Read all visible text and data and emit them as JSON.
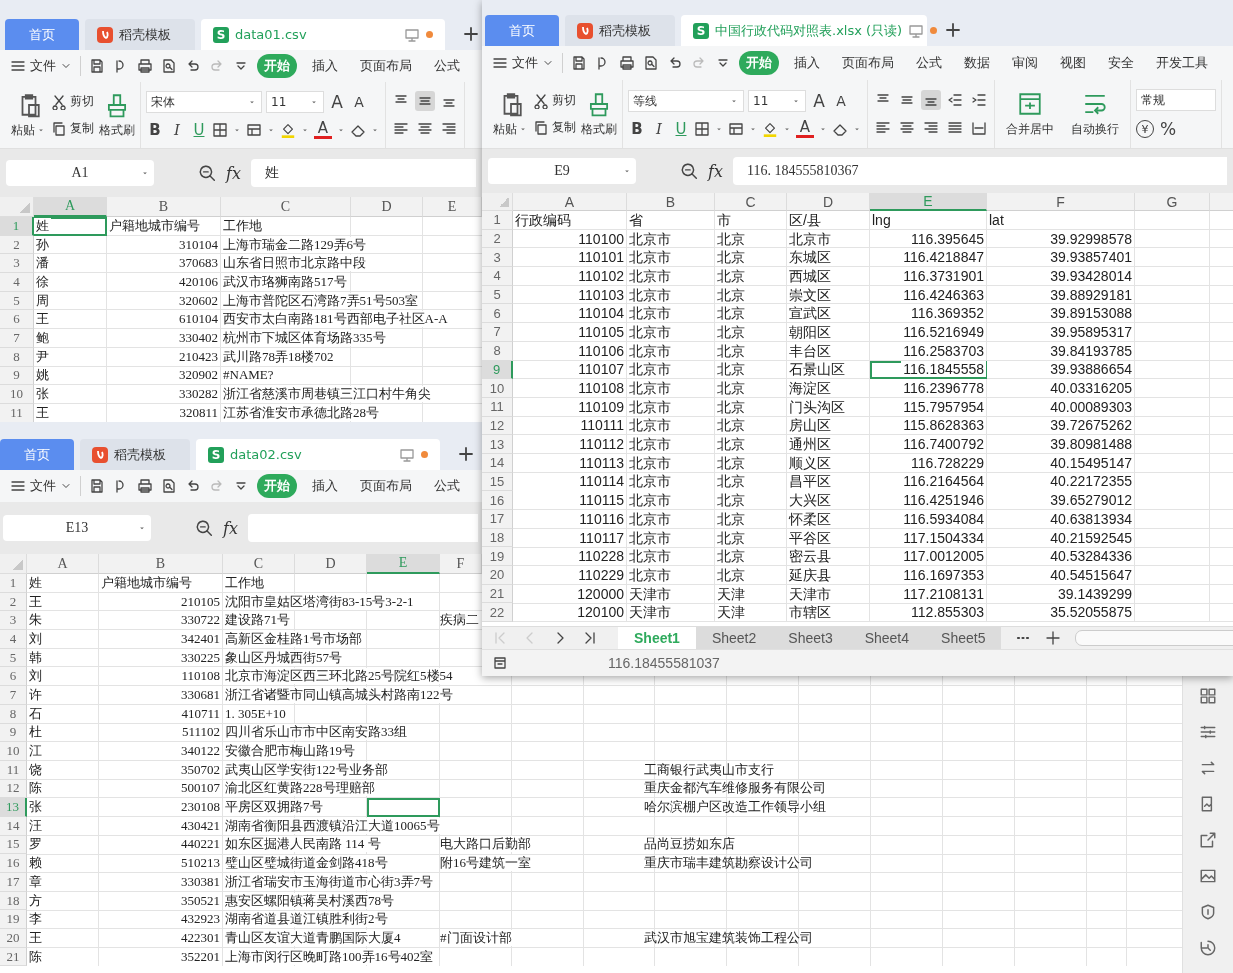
{
  "windows": [
    {
      "kind": "small",
      "tabs": [
        {
          "label": "首页",
          "kind": "home",
          "selected": false
        },
        {
          "label": "稻壳模板",
          "kind": "template",
          "selected": false
        },
        {
          "label": "data01.csv",
          "kind": "sheet",
          "badge": "S",
          "selected": true
        }
      ],
      "menu": {
        "file": "文件",
        "items": [
          {
            "label": "开始",
            "selected": true
          },
          {
            "label": "插入",
            "selected": false
          },
          {
            "label": "页面布局",
            "selected": false
          },
          {
            "label": "公式",
            "selected": false
          }
        ]
      },
      "ribbon": {
        "paste": "粘贴",
        "cut": "剪切",
        "copy": "复制",
        "format_painter": "格式刷",
        "font": "宋体",
        "font_size": "11",
        "grow": "A",
        "shrink": "A",
        "bold": "B",
        "italic": "I",
        "underline": "U",
        "font_color": "A",
        "align_buttons": [
          {
            "selected": false
          },
          {
            "selected": true
          },
          {
            "selected": false
          }
        ]
      },
      "formula_bar": {
        "name_box": "A1",
        "fx": "fx",
        "value": "姓"
      },
      "grid": {
        "columns": [
          {
            "label": "A",
            "selected": true
          },
          {
            "label": "B",
            "selected": false
          },
          {
            "label": "C",
            "selected": false
          },
          {
            "label": "D",
            "selected": false
          },
          {
            "label": "E",
            "selected": false
          }
        ],
        "rows": [
          {
            "num": "1",
            "selected": true,
            "cells": [
              "姓",
              "户籍地城市编号",
              "工作地"
            ]
          },
          {
            "num": "2",
            "selected": false,
            "cells": [
              "孙",
              "310104",
              "上海市瑞金二路129弄6号"
            ]
          },
          {
            "num": "3",
            "selected": false,
            "cells": [
              "潘",
              "370683",
              "山东省日照市北京路中段"
            ]
          },
          {
            "num": "4",
            "selected": false,
            "cells": [
              "徐",
              "420106",
              "武汉市珞狮南路517号"
            ]
          },
          {
            "num": "5",
            "selected": false,
            "cells": [
              "周",
              "320602",
              "上海市普陀区石湾路7弄51号503室"
            ]
          },
          {
            "num": "6",
            "selected": false,
            "cells": [
              "王",
              "610104",
              "西安市太白南路181号西部电子社区A-A"
            ]
          },
          {
            "num": "7",
            "selected": false,
            "cells": [
              "鲍",
              "330402",
              "杭州市下城区体育场路335号"
            ]
          },
          {
            "num": "8",
            "selected": false,
            "cells": [
              "尹",
              "210423",
              "武川路78弄18楼702"
            ]
          },
          {
            "num": "9",
            "selected": false,
            "cells": [
              "姚",
              "320902",
              "#NAME?"
            ]
          },
          {
            "num": "10",
            "selected": false,
            "cells": [
              "张",
              "330282",
              "浙江省慈溪市周巷镇三江口村牛角尖"
            ]
          },
          {
            "num": "11",
            "selected": false,
            "cells": [
              "王",
              "320811",
              "江苏省淮安市承德北路28号"
            ]
          }
        ]
      }
    },
    {
      "kind": "wide",
      "tabs": [
        {
          "label": "首页",
          "kind": "home",
          "selected": false
        },
        {
          "label": "稻壳模板",
          "kind": "template",
          "selected": false
        },
        {
          "label": "data02.csv",
          "kind": "sheet",
          "badge": "S",
          "selected": true
        }
      ],
      "menu": {
        "file": "文件",
        "items": [
          {
            "label": "开始",
            "selected": true
          },
          {
            "label": "插入",
            "selected": false
          },
          {
            "label": "页面布局",
            "selected": false
          },
          {
            "label": "公式",
            "selected": false
          }
        ]
      },
      "formula_bar": {
        "name_box": "E13",
        "fx": "fx"
      },
      "grid": {
        "columns": [
          {
            "label": "A",
            "selected": false
          },
          {
            "label": "B",
            "selected": false
          },
          {
            "label": "C",
            "selected": false
          },
          {
            "label": "D",
            "selected": false
          },
          {
            "label": "E",
            "selected": true
          },
          {
            "label": "F",
            "selected": false
          }
        ],
        "rows": [
          {
            "num": "1",
            "selected": false,
            "cells": [
              "姓",
              "户籍地城市编号",
              "工作地"
            ]
          },
          {
            "num": "2",
            "selected": false,
            "cells": [
              "王",
              "210105",
              "沈阳市皇姑区塔湾街83-15号3-2-1"
            ]
          },
          {
            "num": "3",
            "selected": false,
            "cells": [
              "朱",
              "330722",
              "建设路71号"
            ],
            "column_f": "疾病二"
          },
          {
            "num": "4",
            "selected": false,
            "cells": [
              "刘",
              "342401",
              "高新区金桂路1号市场部"
            ]
          },
          {
            "num": "5",
            "selected": false,
            "cells": [
              "韩",
              "330225",
              "象山区丹城西街57号"
            ]
          },
          {
            "num": "6",
            "selected": false,
            "cells": [
              "刘",
              "110108",
              "北京市海淀区西三环北路25号院红5楼54"
            ]
          },
          {
            "num": "7",
            "selected": false,
            "cells": [
              "许",
              "330681",
              "浙江省诸暨市同山镇高城头村路南122号"
            ]
          },
          {
            "num": "8",
            "selected": false,
            "cells": [
              "石",
              "410711",
              "1. 305E+10"
            ]
          },
          {
            "num": "9",
            "selected": false,
            "cells": [
              "杜",
              "511102",
              "四川省乐山市市中区南安路33组"
            ]
          },
          {
            "num": "10",
            "selected": false,
            "cells": [
              "江",
              "340122",
              "安徽合肥市梅山路19号"
            ]
          },
          {
            "num": "11",
            "selected": false,
            "cells": [
              "饶",
              "350702",
              "武夷山区学安街122号业务部"
            ],
            "column_h": "工商银行武夷山市支行"
          },
          {
            "num": "12",
            "selected": false,
            "cells": [
              "陈",
              "500107",
              "渝北区红黄路228号理赔部"
            ],
            "column_h": "重庆金都汽车维修服务有限公司"
          },
          {
            "num": "13",
            "selected": true,
            "cells": [
              "张",
              "230108",
              "平房区双拥路7号"
            ],
            "column_h": "哈尔滨棚户区改造工作领导小组"
          },
          {
            "num": "14",
            "selected": false,
            "cells": [
              "汪",
              "430421",
              "湖南省衡阳县西渡镇沿江大道10065号"
            ]
          },
          {
            "num": "15",
            "selected": false,
            "cells": [
              "罗",
              "440221",
              "如东区掘港人民南路 114 号"
            ],
            "column_f": "电大路口后勤部",
            "column_h": "品尚豆捞如东店"
          },
          {
            "num": "16",
            "selected": false,
            "cells": [
              "赖",
              "510213",
              "璧山区璧城街道金剑路418号"
            ],
            "column_f": "附16号建筑一室",
            "column_h": "重庆市瑞丰建筑勘察设计公司"
          },
          {
            "num": "17",
            "selected": false,
            "cells": [
              "章",
              "330381",
              "浙江省瑞安市玉海街道市心街3弄7号"
            ]
          },
          {
            "num": "18",
            "selected": false,
            "cells": [
              "方",
              "350521",
              "惠安区螺阳镇蒋吴村溪西78号"
            ]
          },
          {
            "num": "19",
            "selected": false,
            "cells": [
              "李",
              "432923",
              "湖南省道县道江镇胜利街2号"
            ]
          },
          {
            "num": "20",
            "selected": false,
            "cells": [
              "王",
              "422301",
              "青山区友谊大道青鹏国际大厦4"
            ],
            "column_f": "#门面设计部",
            "column_h": "武汉市旭宝建筑装饰工程公司"
          },
          {
            "num": "21",
            "selected": false,
            "cells": [
              "陈",
              "352201",
              "上海市闵行区晚町路100弄16号402室"
            ]
          }
        ]
      }
    },
    {
      "kind": "main",
      "tabs": [
        {
          "label": "首页",
          "kind": "home",
          "selected": false
        },
        {
          "label": "稻壳模板",
          "kind": "template",
          "selected": false
        },
        {
          "label": "中国行政代码对照表.xlsx (只读)",
          "kind": "sheet",
          "badge": "S",
          "selected": true
        }
      ],
      "menu": {
        "file": "文件",
        "items": [
          {
            "label": "开始",
            "selected": true
          },
          {
            "label": "插入",
            "selected": false
          },
          {
            "label": "页面布局",
            "selected": false
          },
          {
            "label": "公式",
            "selected": false
          },
          {
            "label": "数据",
            "selected": false
          },
          {
            "label": "审阅",
            "selected": false
          },
          {
            "label": "视图",
            "selected": false
          },
          {
            "label": "安全",
            "selected": false
          },
          {
            "label": "开发工具",
            "selected": false
          }
        ]
      },
      "ribbon": {
        "paste": "粘贴",
        "cut": "剪切",
        "copy": "复制",
        "format_painter": "格式刷",
        "font": "等线",
        "font_size": "11",
        "grow": "A",
        "shrink": "A",
        "bold": "B",
        "italic": "I",
        "underline": "U",
        "font_color": "A",
        "align_buttons": [
          {
            "selected": false
          },
          {
            "selected": false
          },
          {
            "selected": true
          }
        ],
        "big_buttons": [
          "合并居中",
          "自动换行"
        ],
        "number_format": "常规",
        "currency": "¥",
        "percent": "%"
      },
      "formula_bar": {
        "name_box": "E9",
        "fx": "fx",
        "value": "116. 184555810367"
      },
      "grid": {
        "columns": [
          {
            "label": "A",
            "selected": false
          },
          {
            "label": "B",
            "selected": false
          },
          {
            "label": "C",
            "selected": false
          },
          {
            "label": "D",
            "selected": false
          },
          {
            "label": "E",
            "selected": true
          },
          {
            "label": "F",
            "selected": false
          },
          {
            "label": "G",
            "selected": false
          }
        ],
        "rows": [
          {
            "num": "1",
            "selected": false,
            "cells": [
              "行政编码",
              "省",
              "市",
              "区/县",
              "lng",
              "lat"
            ]
          },
          {
            "num": "2",
            "selected": false,
            "cells": [
              "110100",
              "北京市",
              "北京",
              "北京市",
              "116.395645",
              "39.92998578"
            ]
          },
          {
            "num": "3",
            "selected": false,
            "cells": [
              "110101",
              "北京市",
              "北京",
              "东城区",
              "116.4218847",
              "39.93857401"
            ]
          },
          {
            "num": "4",
            "selected": false,
            "cells": [
              "110102",
              "北京市",
              "北京",
              "西城区",
              "116.3731901",
              "39.93428014"
            ]
          },
          {
            "num": "5",
            "selected": false,
            "cells": [
              "110103",
              "北京市",
              "北京",
              "崇文区",
              "116.4246363",
              "39.88929181"
            ]
          },
          {
            "num": "6",
            "selected": false,
            "cells": [
              "110104",
              "北京市",
              "北京",
              "宣武区",
              "116.369352",
              "39.89153088"
            ]
          },
          {
            "num": "7",
            "selected": false,
            "cells": [
              "110105",
              "北京市",
              "北京",
              "朝阳区",
              "116.5216949",
              "39.95895317"
            ]
          },
          {
            "num": "8",
            "selected": false,
            "cells": [
              "110106",
              "北京市",
              "北京",
              "丰台区",
              "116.2583703",
              "39.84193785"
            ]
          },
          {
            "num": "9",
            "selected": true,
            "cells": [
              "110107",
              "北京市",
              "北京",
              "石景山区",
              "116.1845558",
              "39.93886654"
            ]
          },
          {
            "num": "10",
            "selected": false,
            "cells": [
              "110108",
              "北京市",
              "北京",
              "海淀区",
              "116.2396778",
              "40.03316205"
            ]
          },
          {
            "num": "11",
            "selected": false,
            "cells": [
              "110109",
              "北京市",
              "北京",
              "门头沟区",
              "115.7957954",
              "40.00089303"
            ]
          },
          {
            "num": "12",
            "selected": false,
            "cells": [
              "110111",
              "北京市",
              "北京",
              "房山区",
              "115.8628363",
              "39.72675262"
            ]
          },
          {
            "num": "13",
            "selected": false,
            "cells": [
              "110112",
              "北京市",
              "北京",
              "通州区",
              "116.7400792",
              "39.80981488"
            ]
          },
          {
            "num": "14",
            "selected": false,
            "cells": [
              "110113",
              "北京市",
              "北京",
              "顺义区",
              "116.728229",
              "40.15495147"
            ]
          },
          {
            "num": "15",
            "selected": false,
            "cells": [
              "110114",
              "北京市",
              "北京",
              "昌平区",
              "116.2164564",
              "40.22172355"
            ]
          },
          {
            "num": "16",
            "selected": false,
            "cells": [
              "110115",
              "北京市",
              "北京",
              "大兴区",
              "116.4251946",
              "39.65279012"
            ]
          },
          {
            "num": "17",
            "selected": false,
            "cells": [
              "110116",
              "北京市",
              "北京",
              "怀柔区",
              "116.5934084",
              "40.63813934"
            ]
          },
          {
            "num": "18",
            "selected": false,
            "cells": [
              "110117",
              "北京市",
              "北京",
              "平谷区",
              "117.1504334",
              "40.21592545"
            ]
          },
          {
            "num": "19",
            "selected": false,
            "cells": [
              "110228",
              "北京市",
              "北京",
              "密云县",
              "117.0012005",
              "40.53284336"
            ]
          },
          {
            "num": "20",
            "selected": false,
            "cells": [
              "110229",
              "北京市",
              "北京",
              "延庆县",
              "116.1697353",
              "40.54515647"
            ]
          },
          {
            "num": "21",
            "selected": false,
            "cells": [
              "120000",
              "天津市",
              "天津",
              "天津市",
              "117.2108131",
              "39.1439299"
            ]
          },
          {
            "num": "22",
            "selected": false,
            "cells": [
              "120100",
              "天津市",
              "天津",
              "市辖区",
              "112.855303",
              "35.52055875"
            ]
          }
        ]
      },
      "sheet_tabs": [
        {
          "label": "Sheet1",
          "selected": true
        },
        {
          "label": "Sheet2",
          "selected": false
        },
        {
          "label": "Sheet3",
          "selected": false
        },
        {
          "label": "Sheet4",
          "selected": false
        },
        {
          "label": "Sheet5",
          "selected": false
        }
      ],
      "status_bar": "116.18455581037"
    }
  ]
}
